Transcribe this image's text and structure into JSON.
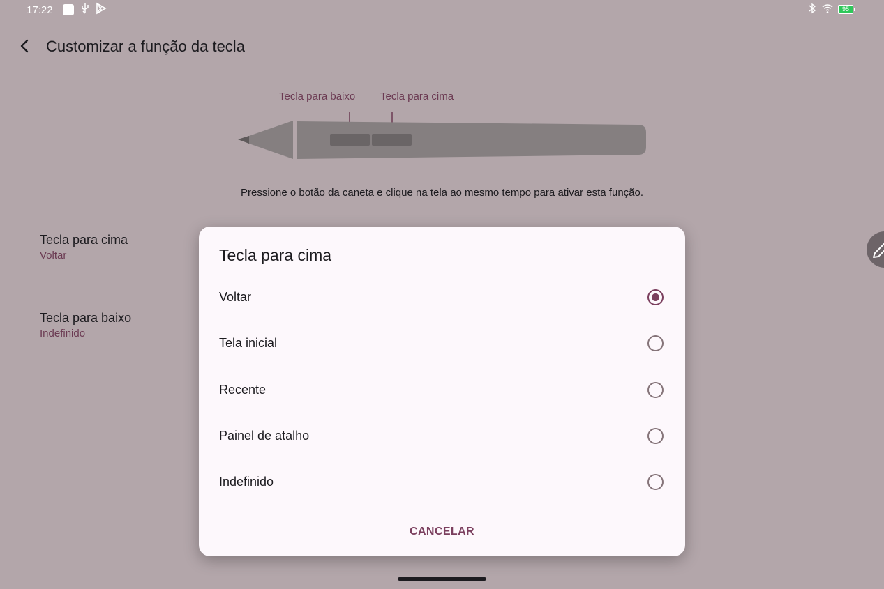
{
  "status_bar": {
    "time": "17:22",
    "battery": "95"
  },
  "header": {
    "title": "Customizar a função da tecla"
  },
  "pen_diagram": {
    "label_down": "Tecla para baixo",
    "label_up": "Tecla para cima"
  },
  "hint": "Pressione o botão da caneta e clique na tela ao mesmo tempo para ativar esta função.",
  "settings": [
    {
      "title": "Tecla para cima",
      "value": "Voltar"
    },
    {
      "title": "Tecla para baixo",
      "value": "Indefinido"
    }
  ],
  "dialog": {
    "title": "Tecla para cima",
    "options": [
      {
        "label": "Voltar",
        "selected": true
      },
      {
        "label": "Tela inicial",
        "selected": false
      },
      {
        "label": "Recente",
        "selected": false
      },
      {
        "label": "Painel de atalho",
        "selected": false
      },
      {
        "label": "Indefinido",
        "selected": false
      }
    ],
    "cancel_label": "CANCELAR"
  },
  "colors": {
    "accent": "#7b3f5e",
    "scrim": "#b3a6aa",
    "dialog_bg": "#fdf8fc"
  }
}
